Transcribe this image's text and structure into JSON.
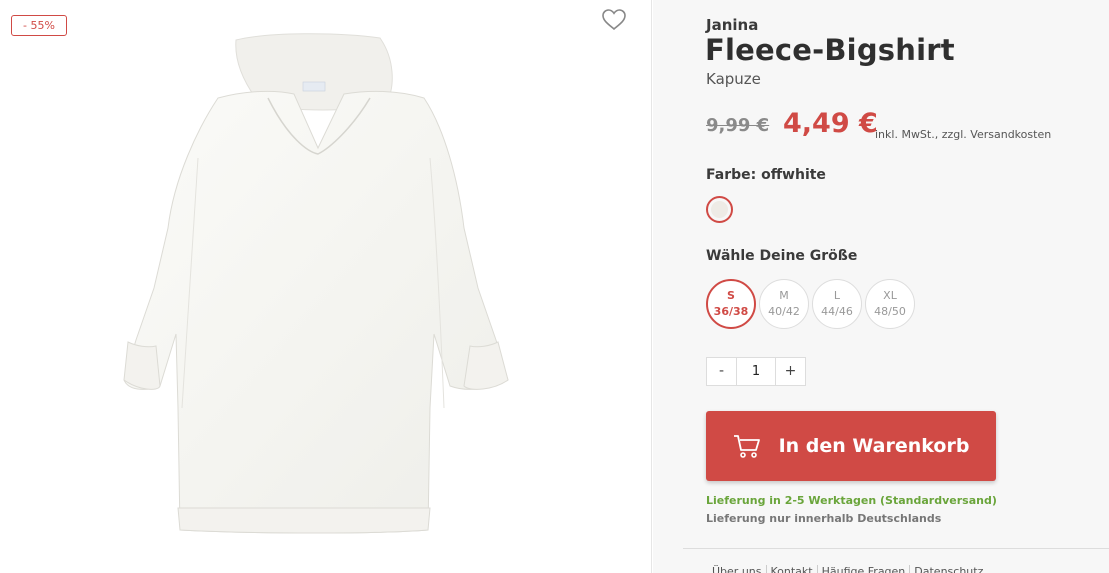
{
  "gallery": {
    "discount_badge": "- 55%",
    "image_alt": "Fleece-Bigshirt offwhite"
  },
  "product": {
    "brand": "Janina",
    "title": "Fleece-Bigshirt",
    "subtitle": "Kapuze",
    "old_price": "9,99 €",
    "new_price": "4,49 €",
    "tax_note": "inkl. MwSt., zzgl. Versandkosten",
    "color_label": "Farbe: offwhite",
    "swatch_color": "#eeebe6",
    "size_label": "Wähle Deine Größe",
    "sizes": [
      {
        "label": "S",
        "range": "36/38",
        "selected": true
      },
      {
        "label": "M",
        "range": "40/42",
        "selected": false
      },
      {
        "label": "L",
        "range": "44/46",
        "selected": false
      },
      {
        "label": "XL",
        "range": "48/50",
        "selected": false
      }
    ],
    "quantity": {
      "minus": "-",
      "value": "1",
      "plus": "+"
    },
    "cart_button": "In den Warenkorb",
    "delivery": "Lieferung in 2-5 Werktagen (Standardversand)",
    "delivery_note": "Lieferung nur innerhalb Deutschlands"
  },
  "footer": {
    "links": [
      "Über uns",
      "Kontakt",
      "Häufige Fragen",
      "Datenschutz"
    ]
  },
  "colors": {
    "accent": "#d04a45",
    "delivery_green": "#6aa53b"
  }
}
